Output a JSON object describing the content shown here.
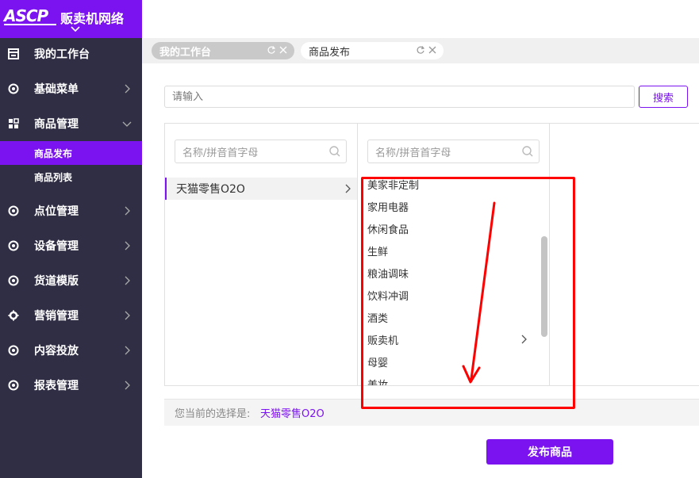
{
  "logo": {
    "mark": "ASCP",
    "text": "贩卖机网络"
  },
  "sidebar": {
    "items": [
      {
        "label": "我的工作台",
        "icon": "dashboard-icon"
      },
      {
        "label": "基础菜单",
        "icon": "circle-dot-icon"
      },
      {
        "label": "商品管理",
        "icon": "grid-icon",
        "expanded": true,
        "children": [
          {
            "label": "商品发布",
            "active": true
          },
          {
            "label": "商品列表"
          }
        ]
      },
      {
        "label": "点位管理",
        "icon": "circle-dot-icon"
      },
      {
        "label": "设备管理",
        "icon": "circle-dot-icon"
      },
      {
        "label": "货道模版",
        "icon": "circle-dot-icon"
      },
      {
        "label": "营销管理",
        "icon": "gear-icon"
      },
      {
        "label": "内容投放",
        "icon": "circle-dot-icon"
      },
      {
        "label": "报表管理",
        "icon": "circle-dot-icon"
      }
    ]
  },
  "tabs": [
    {
      "label": "我的工作台",
      "active": false
    },
    {
      "label": "商品发布",
      "active": true
    }
  ],
  "search": {
    "placeholder": "请输入",
    "button_label": "搜索"
  },
  "category": {
    "col1_placeholder": "名称/拼音首字母",
    "col2_placeholder": "名称/拼音首字母",
    "col1_items": [
      "天猫零售O2O"
    ],
    "col2_items": [
      "美家非定制",
      "家用电器",
      "休闲食品",
      "生鲜",
      "粮油调味",
      "饮料冲调",
      "酒类",
      "贩卖机",
      "母婴",
      "美妆"
    ]
  },
  "selection": {
    "label": "您当前的选择是:",
    "value": "天猫零售O2O"
  },
  "publish_button": "发布商品",
  "colors": {
    "accent": "#7b12f0",
    "sidebar_bg": "#302e44",
    "annotation": "#ff0000"
  }
}
